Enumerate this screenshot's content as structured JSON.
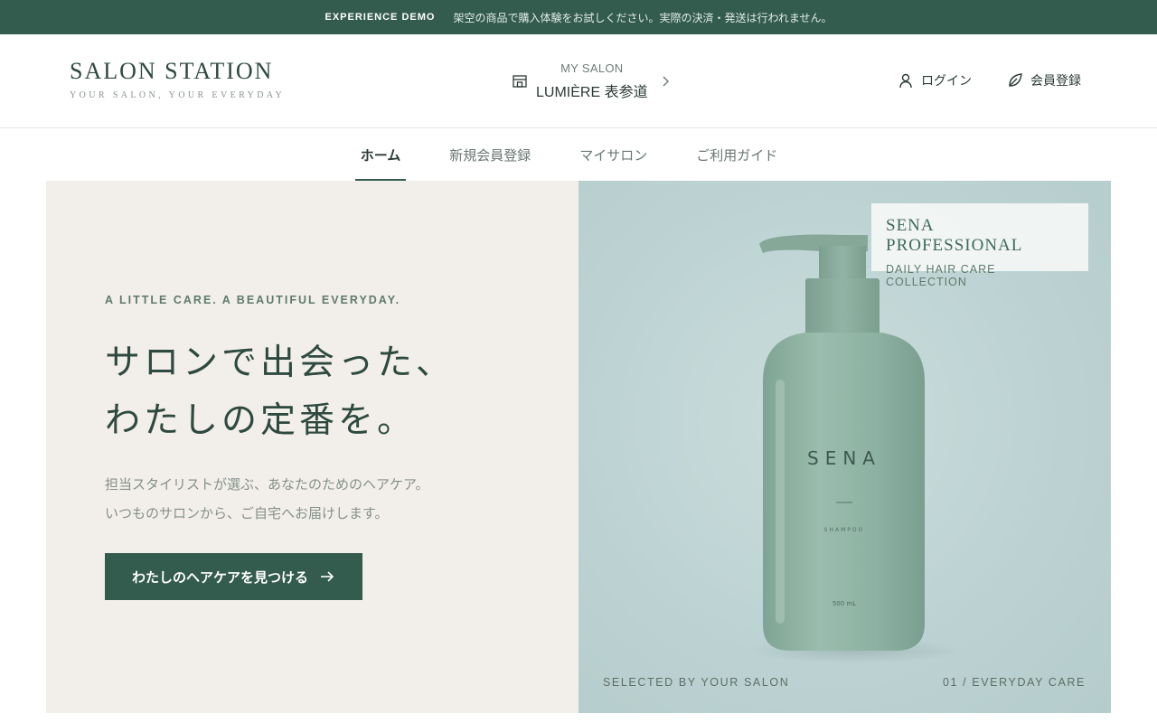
{
  "topbar": {
    "tag": "EXPERIENCE DEMO",
    "message": "架空の商品で購入体験をお試しください。実際の決済・発送は行われません。"
  },
  "header": {
    "logo_title": "SALON STATION",
    "logo_subtitle": "YOUR SALON, YOUR EVERYDAY",
    "my_salon_label": "MY SALON",
    "my_salon_name": "LUMIÈRE 表参道",
    "login_label": "ログイン",
    "register_label": "会員登録"
  },
  "nav": {
    "items": [
      {
        "label": "ホーム",
        "active": true
      },
      {
        "label": "新規会員登録",
        "active": false
      },
      {
        "label": "マイサロン",
        "active": false
      },
      {
        "label": "ご利用ガイド",
        "active": false
      }
    ]
  },
  "hero": {
    "eyebrow": "A LITTLE CARE. A BEAUTIFUL EVERYDAY.",
    "headline_line1": "サロンで出会った、",
    "headline_line2": "わたしの定番を。",
    "body_line1": "担当スタイリストが選ぶ、あなたのためのヘアケア。",
    "body_line2": "いつものサロンから、ご自宅へお届けします。",
    "cta_label": "わたしのヘアケアを見つける",
    "brand_title": "SENA PROFESSIONAL",
    "brand_subtitle": "DAILY HAIR CARE COLLECTION",
    "caption_left": "SELECTED BY YOUR SALON",
    "caption_right": "01 / EVERYDAY CARE",
    "bottle_brand": "SENA",
    "bottle_type": "SHAMPOO",
    "bottle_volume": "500 mL"
  },
  "colors": {
    "brand_green": "#335c4e",
    "hero_left_bg": "#f2efea",
    "hero_right_bg": "#bdd3d3",
    "bottle": "#8fb3a4"
  }
}
